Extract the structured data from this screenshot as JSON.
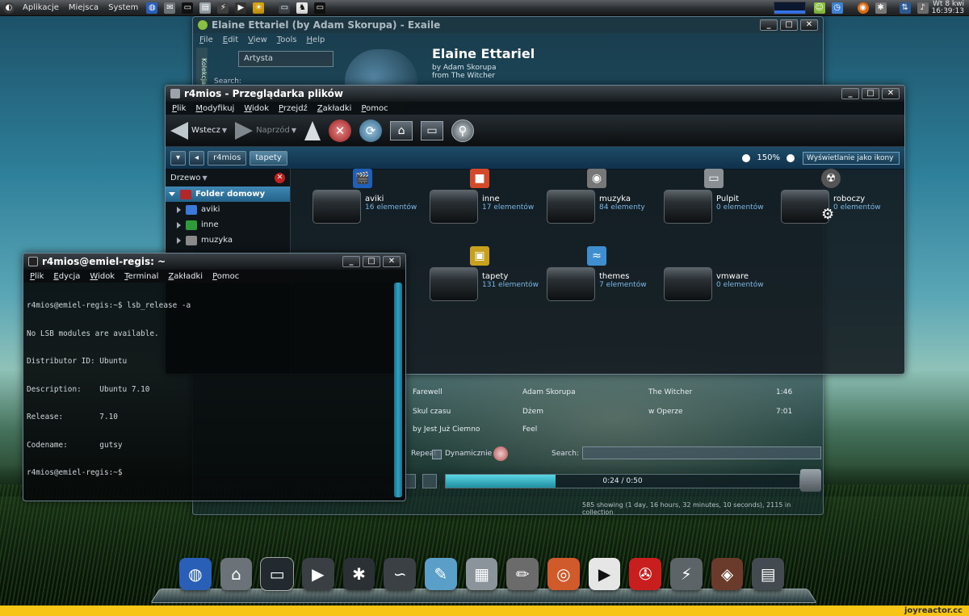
{
  "top_panel": {
    "menus": [
      "Aplikacje",
      "Miejsca",
      "System"
    ],
    "clock_day": "Wt",
    "clock_date": "8 kwi",
    "clock_time": "16:39:13"
  },
  "player": {
    "title": "Elaine Ettariel (by Adam Skorupa) - Exaile",
    "menus": [
      "File",
      "Edit",
      "View",
      "Tools",
      "Help"
    ],
    "side_tab": "Kolekcja",
    "artist_combo": "Artysta",
    "search_small": "Search:",
    "track_title": "Elaine Ettariel",
    "track_artist": "by Adam Skorupa",
    "track_album": "from The Witcher",
    "rows": [
      {
        "title": "Farewell",
        "artist": "Adam Skorupa",
        "album": "The Witcher",
        "length": "1:46"
      },
      {
        "title": "Skul czasu",
        "artist": "Dżem",
        "album": "w Operze",
        "length": "7:01"
      },
      {
        "title": "by Jest Już Ciemno",
        "artist": "Feel",
        "album": "",
        "length": ""
      }
    ],
    "repeat_label": "Repeat",
    "dynamic_label": "Dynamicznie",
    "search_label": "Search:",
    "time": "0:24 / 0:50",
    "seek_progress": 0.31,
    "status": "585 showing (1 day, 16 hours, 32 minutes, 10 seconds), 2115 in collection"
  },
  "browser": {
    "title": "r4mios - Przeglądarka plików",
    "menus": [
      "Plik",
      "Modyfikuj",
      "Widok",
      "Przejdź",
      "Zakładki",
      "Pomoc"
    ],
    "back_label": "Wstecz",
    "forward_label": "Naprzód",
    "path": [
      "r4mios",
      "tapety"
    ],
    "zoom": "150%",
    "view_mode": "Wyświetlanie jako ikony",
    "side_pane_label": "Drzewo",
    "tree": [
      {
        "label": "Folder domowy",
        "color": "#b3262a"
      },
      {
        "label": "aviki",
        "color": "#3c78d8"
      },
      {
        "label": "inne",
        "color": "#2e9a3a"
      },
      {
        "label": "muzyka",
        "color": "#8a8a8a"
      }
    ],
    "folders": [
      {
        "name": "aviki",
        "count": "16 elementów",
        "emblem": "🎬",
        "color": "#1f5fb8"
      },
      {
        "name": "inne",
        "count": "17 elementów",
        "emblem": "■",
        "color": "#d24a2a"
      },
      {
        "name": "muzyka",
        "count": "84 elementy",
        "emblem": "◉",
        "color": "#777777"
      },
      {
        "name": "Pulpit",
        "count": "0 elementów",
        "emblem": "▭",
        "color": "#8a8f93"
      },
      {
        "name": "roboczy",
        "count": "0 elementów",
        "emblem": "☢",
        "color": "#555555"
      },
      {
        "name": "tapety",
        "count": "131 elementów",
        "emblem": "▣",
        "color": "#c8a020"
      },
      {
        "name": "themes",
        "count": "7 elementów",
        "emblem": "≈",
        "color": "#3f8fd0"
      },
      {
        "name": "vmware",
        "count": "0 elementów",
        "emblem": "",
        "color": "transparent"
      }
    ]
  },
  "terminal": {
    "title": "r4mios@emiel-regis: ~",
    "menus": [
      "Plik",
      "Edycja",
      "Widok",
      "Terminal",
      "Zakładki",
      "Pomoc"
    ],
    "lines": [
      "r4mios@emiel-regis:~$ lsb_release -a",
      "No LSB modules are available.",
      "Distributor ID: Ubuntu",
      "Description:    Ubuntu 7.10",
      "Release:        7.10",
      "Codename:       gutsy",
      "r4mios@emiel-regis:~$"
    ]
  },
  "dock": {
    "items": [
      {
        "name": "browser-icon",
        "glyph": "◍",
        "color": "#2a5fb8"
      },
      {
        "name": "home-folder-icon",
        "glyph": "⌂",
        "color": "#6b7378"
      },
      {
        "name": "terminal-icon",
        "glyph": "▭",
        "color": "#222a2f"
      },
      {
        "name": "media-player-icon",
        "glyph": "▶",
        "color": "#3a3f43"
      },
      {
        "name": "accessibility-icon",
        "glyph": "✱",
        "color": "#2b3034"
      },
      {
        "name": "swoosh-icon",
        "glyph": "∽",
        "color": "#3a4044"
      },
      {
        "name": "text-editor-icon",
        "glyph": "✎",
        "color": "#5a9fc8"
      },
      {
        "name": "image-viewer-icon",
        "glyph": "▦",
        "color": "#8a949a"
      },
      {
        "name": "gimp-icon",
        "glyph": "✏",
        "color": "#6b6b6b"
      },
      {
        "name": "cd-burner-icon",
        "glyph": "◎",
        "color": "#d05a2a"
      },
      {
        "name": "play-circle-icon",
        "glyph": "▶",
        "color": "#e6e6e6"
      },
      {
        "name": "pdf-reader-icon",
        "glyph": "✇",
        "color": "#c81e1e"
      },
      {
        "name": "flash-icon",
        "glyph": "⚡",
        "color": "#5c6468"
      },
      {
        "name": "burn-icon",
        "glyph": "◈",
        "color": "#6a3a2a"
      },
      {
        "name": "drive-icon",
        "glyph": "▤",
        "color": "#444b50"
      }
    ]
  },
  "watermark": "joyreactor.cc"
}
